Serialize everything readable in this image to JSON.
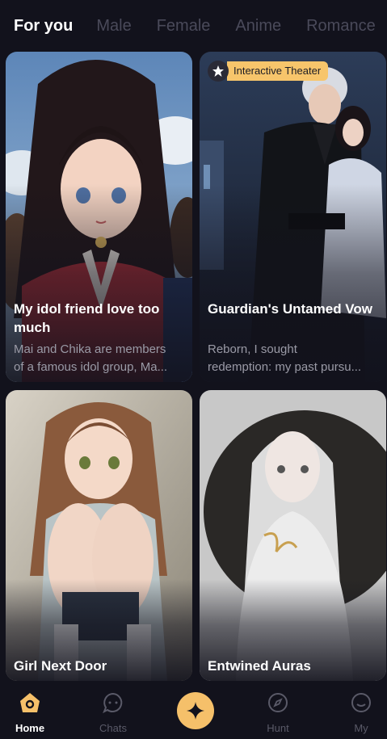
{
  "tabs": [
    {
      "label": "For you",
      "active": true
    },
    {
      "label": "Male",
      "active": false
    },
    {
      "label": "Female",
      "active": false
    },
    {
      "label": "Anime",
      "active": false
    },
    {
      "label": "Romance",
      "active": false
    }
  ],
  "cards": [
    {
      "title": "My idol friend love too much",
      "title_lines": [
        "My idol friend love too",
        "much"
      ],
      "desc_lines": [
        "Mai and Chika are members",
        "of a famous idol group, Ma..."
      ],
      "badge": null
    },
    {
      "title": "Guardian's Untamed Vow",
      "title_lines": [
        "Guardian's Untamed Vow"
      ],
      "desc_lines": [
        "Reborn, I sought",
        "redemption: my past pursu..."
      ],
      "badge": "Interactive Theater"
    },
    {
      "title": "Girl Next Door",
      "title_lines": [
        "Girl Next Door"
      ],
      "desc_lines": [],
      "badge": null
    },
    {
      "title": "Entwined Auras",
      "title_lines": [
        "Entwined Auras"
      ],
      "desc_lines": [],
      "badge": null
    }
  ],
  "nav": {
    "home": {
      "label": "Home",
      "icon": "home-icon",
      "active": true
    },
    "chats": {
      "label": "Chats",
      "icon": "chat-icon",
      "active": false
    },
    "create": {
      "icon": "sparkle-icon"
    },
    "hunt": {
      "label": "Hunt",
      "icon": "compass-icon",
      "active": false
    },
    "my": {
      "label": "My",
      "icon": "smile-face-icon",
      "active": false
    }
  },
  "colors": {
    "background": "#12121c",
    "accent": "#f5c06a",
    "badge": "#f7c56b",
    "inactive_tab": "#4a4a5a"
  }
}
